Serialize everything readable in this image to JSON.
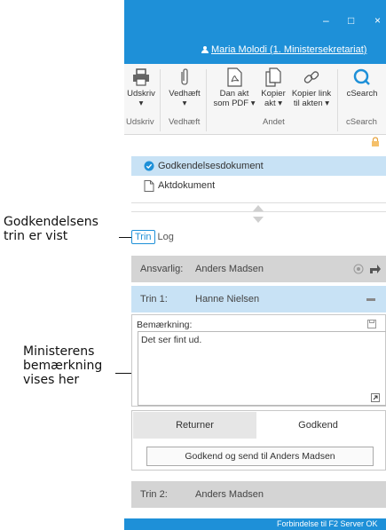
{
  "callouts": {
    "steps_line1": "Godkendelsens",
    "steps_line2": "trin er vist",
    "remark_line1": "Ministerens",
    "remark_line2": "bemærkning",
    "remark_line3": "vises her"
  },
  "titlebar": {
    "minimize": "–",
    "maximize": "□",
    "close": "×",
    "user": "Maria Molodi (1. Ministersekretariat)"
  },
  "ribbon": {
    "buttons": [
      {
        "label1": "Udskriv",
        "label2": "▾",
        "icon": "printer-icon"
      },
      {
        "label1": "Vedhæft",
        "label2": "▾",
        "icon": "paperclip-icon"
      },
      {
        "label1": "Dan akt",
        "label2": "som PDF ▾",
        "icon": "pdf-icon"
      },
      {
        "label1": "Kopier",
        "label2": "akt ▾",
        "icon": "copy-icon"
      },
      {
        "label1": "Kopier link",
        "label2": "til akten ▾",
        "icon": "link-icon"
      },
      {
        "label1": "cSearch",
        "label2": "",
        "icon": "search-icon"
      }
    ],
    "groups": [
      "Udskriv",
      "Vedhæft",
      "Andet",
      "cSearch"
    ]
  },
  "documents": [
    {
      "name": "Godkendelsesdokument",
      "selected": true,
      "icon": "check-circle-icon"
    },
    {
      "name": "Aktdokument",
      "selected": false,
      "icon": "document-icon"
    }
  ],
  "tabs": [
    "Trin",
    "Log"
  ],
  "responsible": {
    "label": "Ansvarlig:",
    "name": "Anders Madsen"
  },
  "steps": [
    {
      "label": "Trin 1:",
      "name": "Hanne Nielsen"
    },
    {
      "label": "Trin 2:",
      "name": "Anders Madsen"
    }
  ],
  "remark": {
    "label": "Bemærkning:",
    "text": "Det ser fint ud."
  },
  "actions": {
    "return": "Returner",
    "approve": "Godkend",
    "approve_send": "Godkend og send til Anders Madsen"
  },
  "status": "Forbindelse til F2 Server OK",
  "colors": {
    "accent": "#1e90d8",
    "selected": "#c8e2f5",
    "header_gray": "#d4d4d4"
  }
}
